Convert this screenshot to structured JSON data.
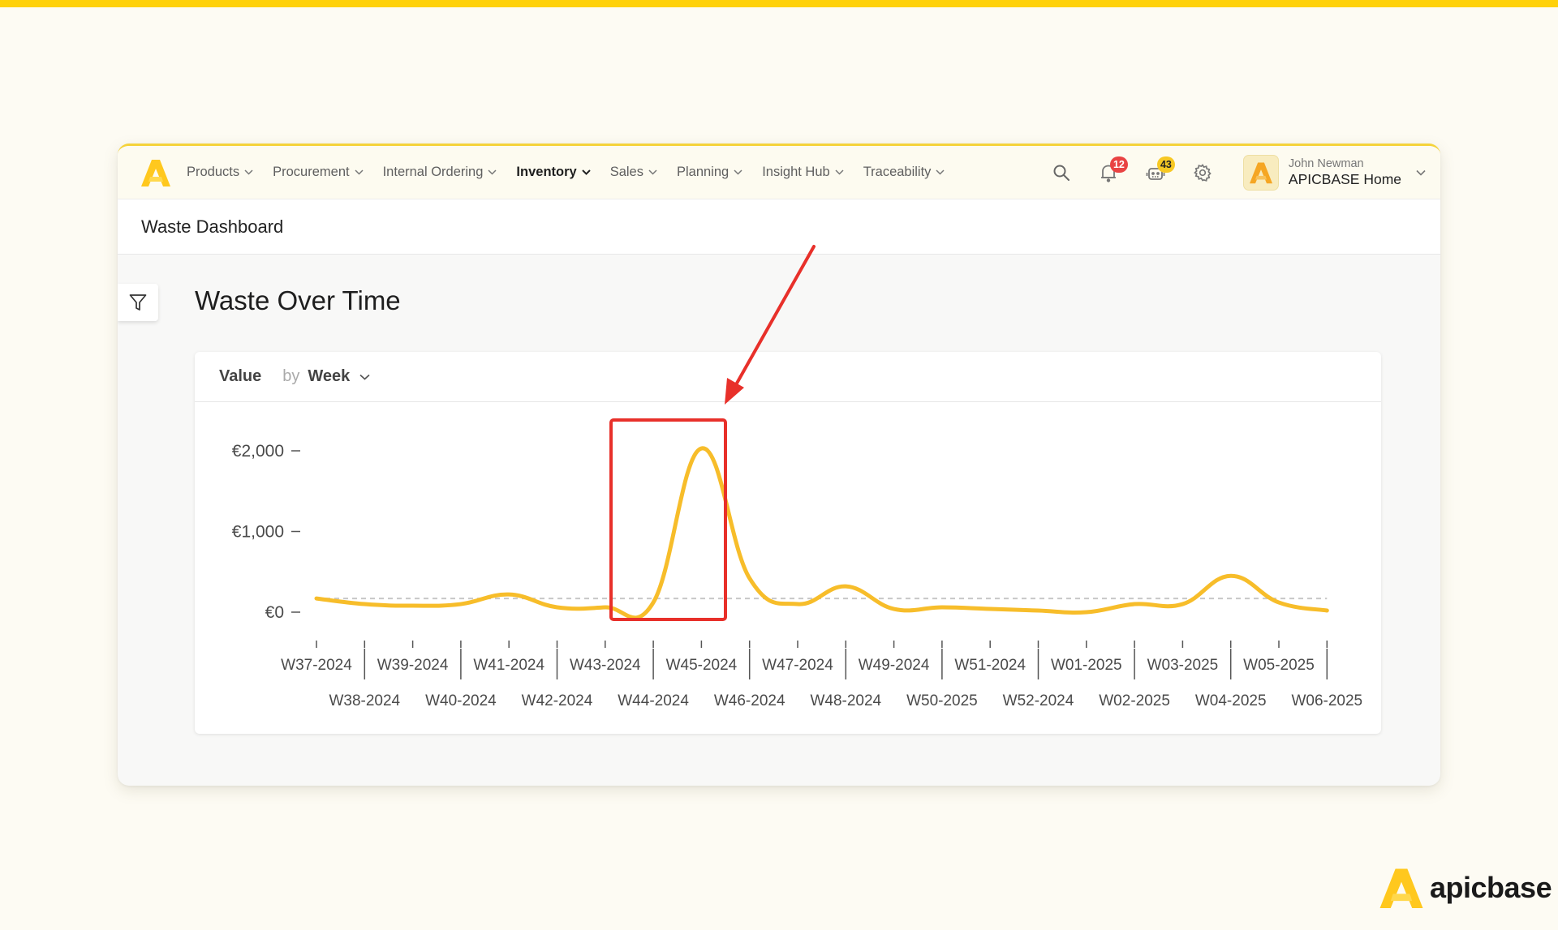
{
  "nav": {
    "items": [
      {
        "label": "Products",
        "active": false
      },
      {
        "label": "Procurement",
        "active": false
      },
      {
        "label": "Internal Ordering",
        "active": false
      },
      {
        "label": "Inventory",
        "active": true
      },
      {
        "label": "Sales",
        "active": false
      },
      {
        "label": "Planning",
        "active": false
      },
      {
        "label": "Insight Hub",
        "active": false
      },
      {
        "label": "Traceability",
        "active": false
      }
    ],
    "icons": {
      "search": "search-icon",
      "notifications": "bell-icon",
      "assistant": "robot-icon",
      "settings": "gear-icon"
    },
    "notifications_count": "12",
    "assistant_count": "43",
    "user": {
      "name": "John Newman",
      "organization": "APICBASE Home"
    }
  },
  "page": {
    "title": "Waste Dashboard",
    "section_title": "Waste Over Time"
  },
  "card": {
    "metric_label": "Value",
    "by_label": "by",
    "group_by": "Week"
  },
  "brand": {
    "name": "apicbase"
  },
  "colors": {
    "accent": "#ffd10a",
    "line": "#f7bd2a",
    "annotation": "#e8302a",
    "reference_line": "#c8c8c8"
  },
  "annotation": {
    "highlight_category": "W45-2024",
    "type": "red box with arrow"
  },
  "chart_data": {
    "type": "line",
    "title": "Waste Over Time",
    "xlabel": "",
    "ylabel": "Value",
    "currency": "€",
    "ylim": [
      0,
      2000
    ],
    "yticks": [
      {
        "value": 0,
        "label": "€0"
      },
      {
        "value": 1000,
        "label": "€1,000"
      },
      {
        "value": 2000,
        "label": "€2,000"
      }
    ],
    "categories": [
      "W37-2024",
      "W38-2024",
      "W39-2024",
      "W40-2024",
      "W41-2024",
      "W42-2024",
      "W43-2024",
      "W44-2024",
      "W45-2024",
      "W46-2024",
      "W47-2024",
      "W48-2024",
      "W49-2024",
      "W50-2025",
      "W51-2024",
      "W52-2024",
      "W01-2025",
      "W02-2025",
      "W03-2025",
      "W04-2025",
      "W05-2025",
      "W06-2025"
    ],
    "series": [
      {
        "name": "Value",
        "values": [
          170,
          100,
          80,
          100,
          220,
          60,
          60,
          120,
          2030,
          420,
          100,
          320,
          40,
          60,
          40,
          20,
          0,
          100,
          100,
          450,
          120,
          20
        ]
      }
    ],
    "reference_line": {
      "value": 170,
      "style": "dashed"
    },
    "grid": false,
    "legend": "none"
  }
}
